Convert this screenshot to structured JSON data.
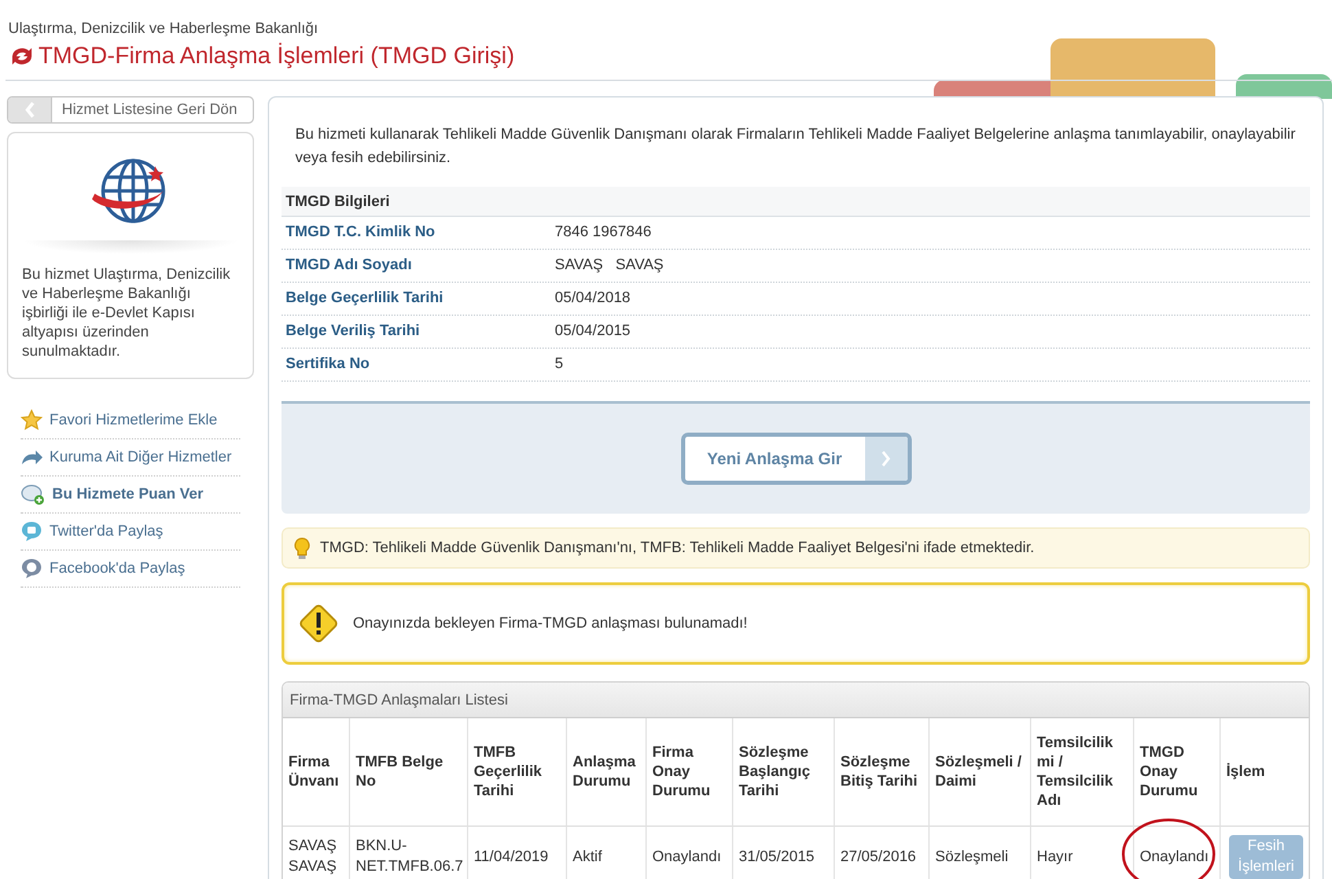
{
  "header": {
    "ministry": "Ulaştırma, Denizcilik ve Haberleşme Bakanlığı",
    "title": "TMGD-Firma Anlaşma İşlemleri (TMGD Girişi)"
  },
  "sidebar": {
    "back_button": "Hizmet Listesine Geri Dön",
    "info": "Bu hizmet Ulaştırma, Denizcilik ve Haberleşme Bakanlığı işbirliği ile e-Devlet Kapısı altyapısı üzerinden sunulmaktadır.",
    "links": [
      {
        "kind": "star",
        "label": "Favori Hizmetlerime Ekle",
        "bold": false
      },
      {
        "kind": "arrow",
        "label": "Kuruma Ait Diğer Hizmetler",
        "bold": false
      },
      {
        "kind": "rate",
        "label": "Bu Hizmete Puan Ver",
        "bold": true
      },
      {
        "kind": "twitter",
        "label": "Twitter'da Paylaş",
        "bold": false
      },
      {
        "kind": "facebook",
        "label": "Facebook'da Paylaş",
        "bold": false
      }
    ]
  },
  "intro": "Bu hizmeti kullanarak Tehlikeli Madde Güvenlik Danışmanı olarak Firmaların Tehlikeli Madde Faaliyet Belgelerine anlaşma tanımlayabilir, onaylayabilir veya fesih edebilirsiniz.",
  "info_table": {
    "title": "TMGD Bilgileri",
    "rows": [
      {
        "label": "TMGD T.C. Kimlik No",
        "value": "7846 1967846"
      },
      {
        "label": "TMGD Adı Soyadı",
        "value": "SAVAŞ   SAVAŞ"
      },
      {
        "label": "Belge Geçerlilik Tarihi",
        "value": "05/04/2018"
      },
      {
        "label": "Belge Veriliş Tarihi",
        "value": "05/04/2015"
      },
      {
        "label": "Sertifika No",
        "value": "5"
      }
    ]
  },
  "new_button": "Yeni Anlaşma Gir",
  "tip": "TMGD: Tehlikeli Madde Güvenlik Danışmanı'nı, TMFB: Tehlikeli Madde Faaliyet Belgesi'ni ifade etmektedir.",
  "warning": "Onayınızda bekleyen Firma-TMGD anlaşması bulunamadı!",
  "list": {
    "title": "Firma-TMGD Anlaşmaları Listesi",
    "columns": [
      "Firma Ünvanı",
      "TMFB Belge No",
      "TMFB Geçerlilik Tarihi",
      "Anlaşma Durumu",
      "Firma Onay Durumu",
      "Sözleşme Başlangıç Tarihi",
      "Sözleşme Bitiş Tarihi",
      "Sözleşmeli / Daimi",
      "Temsilcilik mi / Temsilcilik Adı",
      "TMGD Onay Durumu",
      "İşlem"
    ],
    "rows": [
      {
        "cells": [
          {
            "text": "SAVAŞ SAVAŞ",
            "circled": false
          },
          {
            "text": "BKN.U-NET.TMFB.06.7",
            "circled": false
          },
          {
            "text": "11/04/2019",
            "circled": false
          },
          {
            "text": "Aktif",
            "circled": false
          },
          {
            "text": "Onaylandı",
            "circled": false
          },
          {
            "text": "31/05/2015",
            "circled": false
          },
          {
            "text": "27/05/2016",
            "circled": false
          },
          {
            "text": "Sözleşmeli",
            "circled": false
          },
          {
            "text": "Hayır",
            "circled": false
          },
          {
            "text": "Onaylandı",
            "circled": true
          }
        ],
        "action": "Fesih İşlemleri"
      }
    ]
  }
}
